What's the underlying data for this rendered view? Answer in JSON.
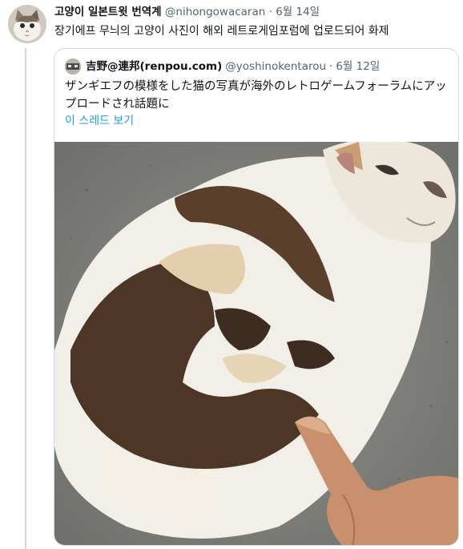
{
  "tweet": {
    "author_name": "고양이 일본트윗 번역계",
    "handle": "@nihongowacaran",
    "separator": "·",
    "date": "6월 14일",
    "text": "장기에프 무늬의 고양이 사진이 해외 레트로게임포럼에 업로드되어 화제"
  },
  "quoted_tweet": {
    "author_name": "吉野@連邦(renpou.com)",
    "handle": "@yoshinokentarou",
    "separator": "·",
    "date": "6월 12일",
    "text": "ザンギエフの模様をした猫の写真が海外のレトロゲームフォーラムにアップロードされ話題に",
    "show_thread_label": "이 스레드 보기"
  },
  "colors": {
    "link": "#1d9bf0",
    "secondary_text": "#536471",
    "border": "#cfd9de"
  }
}
